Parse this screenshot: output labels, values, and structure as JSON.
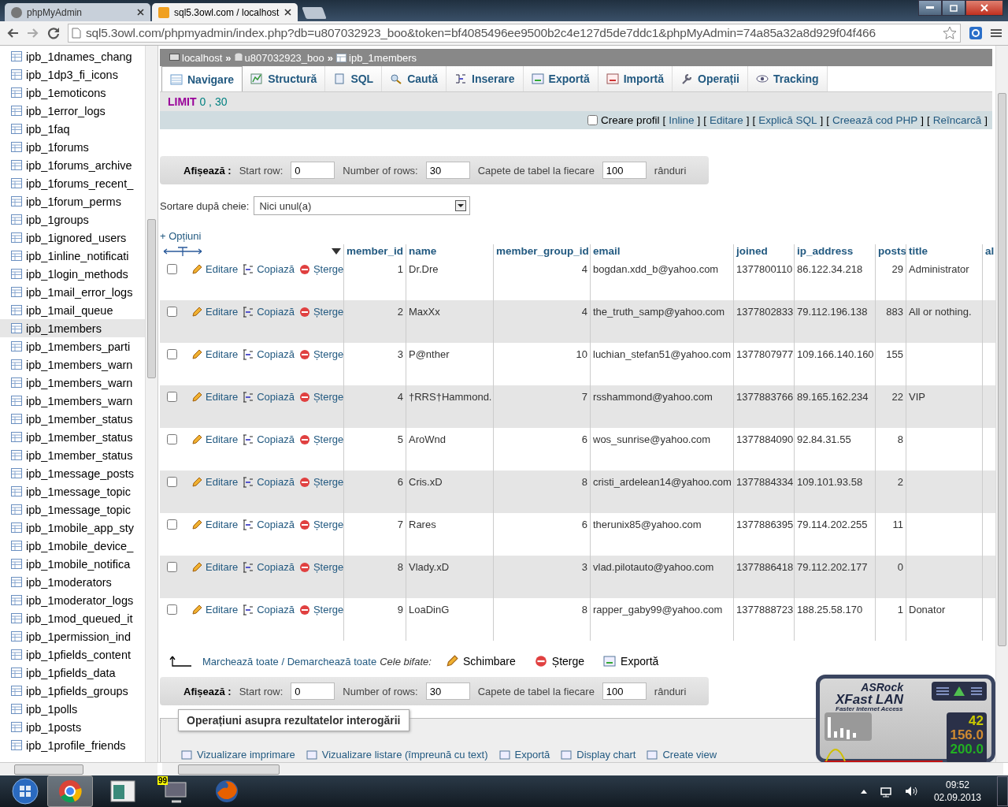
{
  "browser": {
    "tabs": [
      {
        "label": "phpMyAdmin",
        "selected": false
      },
      {
        "label": "sql5.3owl.com / localhost",
        "selected": true
      }
    ],
    "url": "sql5.3owl.com/phpmyadmin/index.php?db=u807032923_boo&token=bf4085496ee9500b2c4e127d5de7ddc1&phpMyAdmin=74a85a32a8d929f04f466"
  },
  "sidebar": {
    "items": [
      {
        "label": "ipb_1dnames_chang",
        "selected": false
      },
      {
        "label": "ipb_1dp3_fi_icons",
        "selected": false
      },
      {
        "label": "ipb_1emoticons",
        "selected": false
      },
      {
        "label": "ipb_1error_logs",
        "selected": false
      },
      {
        "label": "ipb_1faq",
        "selected": false
      },
      {
        "label": "ipb_1forums",
        "selected": false
      },
      {
        "label": "ipb_1forums_archive",
        "selected": false
      },
      {
        "label": "ipb_1forums_recent_",
        "selected": false
      },
      {
        "label": "ipb_1forum_perms",
        "selected": false
      },
      {
        "label": "ipb_1groups",
        "selected": false
      },
      {
        "label": "ipb_1ignored_users",
        "selected": false
      },
      {
        "label": "ipb_1inline_notificati",
        "selected": false
      },
      {
        "label": "ipb_1login_methods",
        "selected": false
      },
      {
        "label": "ipb_1mail_error_logs",
        "selected": false
      },
      {
        "label": "ipb_1mail_queue",
        "selected": false
      },
      {
        "label": "ipb_1members",
        "selected": true
      },
      {
        "label": "ipb_1members_parti",
        "selected": false
      },
      {
        "label": "ipb_1members_warn",
        "selected": false
      },
      {
        "label": "ipb_1members_warn",
        "selected": false
      },
      {
        "label": "ipb_1members_warn",
        "selected": false
      },
      {
        "label": "ipb_1member_status",
        "selected": false
      },
      {
        "label": "ipb_1member_status",
        "selected": false
      },
      {
        "label": "ipb_1member_status",
        "selected": false
      },
      {
        "label": "ipb_1message_posts",
        "selected": false
      },
      {
        "label": "ipb_1message_topic",
        "selected": false
      },
      {
        "label": "ipb_1message_topic",
        "selected": false
      },
      {
        "label": "ipb_1mobile_app_sty",
        "selected": false
      },
      {
        "label": "ipb_1mobile_device_",
        "selected": false
      },
      {
        "label": "ipb_1mobile_notifica",
        "selected": false
      },
      {
        "label": "ipb_1moderators",
        "selected": false
      },
      {
        "label": "ipb_1moderator_logs",
        "selected": false
      },
      {
        "label": "ipb_1mod_queued_it",
        "selected": false
      },
      {
        "label": "ipb_1permission_ind",
        "selected": false
      },
      {
        "label": "ipb_1pfields_content",
        "selected": false
      },
      {
        "label": "ipb_1pfields_data",
        "selected": false
      },
      {
        "label": "ipb_1pfields_groups",
        "selected": false
      },
      {
        "label": "ipb_1polls",
        "selected": false
      },
      {
        "label": "ipb_1posts",
        "selected": false
      },
      {
        "label": "ipb_1profile_friends",
        "selected": false
      }
    ]
  },
  "breadcrumb": [
    {
      "kind": "server",
      "label": "localhost",
      "separator": "»"
    },
    {
      "kind": "database",
      "label": "u807032923_boo",
      "separator": "»"
    },
    {
      "kind": "table",
      "label": "ipb_1members"
    }
  ],
  "tabs": [
    {
      "kind": "browse",
      "label": "Navigare",
      "selected": true
    },
    {
      "kind": "structure",
      "label": "Structură",
      "selected": false
    },
    {
      "kind": "sql",
      "label": "SQL",
      "selected": false
    },
    {
      "kind": "search",
      "label": "Caută",
      "selected": false
    },
    {
      "kind": "insert",
      "label": "Inserare",
      "selected": false
    },
    {
      "kind": "export",
      "label": "Exportă",
      "selected": false
    },
    {
      "kind": "import",
      "label": "Importă",
      "selected": false
    },
    {
      "kind": "operations",
      "label": "Operații",
      "selected": false
    },
    {
      "kind": "tracking",
      "label": "Tracking",
      "selected": false
    }
  ],
  "sql": {
    "keyword": "LIMIT",
    "value": "0 , 30"
  },
  "query_links": {
    "checkbox_label": "Creare profil",
    "checked": false,
    "links": [
      {
        "open": "[",
        "label": "Inline",
        "close": "]"
      },
      {
        "open": "[",
        "label": "Editare",
        "close": "]"
      },
      {
        "open": "[",
        "label": "Explică SQL",
        "close": "]"
      },
      {
        "open": "[",
        "label": "Creează cod PHP",
        "close": "]"
      },
      {
        "open": "[",
        "label": "Reîncarcă",
        "close": "]"
      }
    ]
  },
  "navigation_top": {
    "title": "Afișează :",
    "start_label": "Start row:",
    "start": "0",
    "rows_label": "Number of rows:",
    "rows": "30",
    "headers_label": "Capete de tabel la fiecare",
    "headers": "100",
    "suffix": "rânduri"
  },
  "sort": {
    "label": "Sortare după cheie:",
    "value": "Nici unul(a)"
  },
  "options_link": "+ Opțiuni",
  "table": {
    "columns": [
      "member_id",
      "name",
      "member_group_id",
      "email",
      "joined",
      "ip_address",
      "posts",
      "title",
      "al"
    ],
    "rows": [
      {
        "checked": false,
        "actions": [
          "Editare",
          "Copiază",
          "Șterge"
        ],
        "cells": [
          "1",
          "Dr.Dre",
          "4",
          "bogdan.xdd_b@yahoo.com",
          "1377800110",
          "86.122.34.218",
          "29",
          "Administrator"
        ]
      },
      {
        "checked": false,
        "actions": [
          "Editare",
          "Copiază",
          "Șterge"
        ],
        "cells": [
          "2",
          "MaxXx",
          "4",
          "the_truth_samp@yahoo.com",
          "1377802833",
          "79.112.196.138",
          "883",
          "All or nothing."
        ]
      },
      {
        "checked": false,
        "actions": [
          "Editare",
          "Copiază",
          "Șterge"
        ],
        "cells": [
          "3",
          "P@nther",
          "10",
          "luchian_stefan51@yahoo.com",
          "1377807977",
          "109.166.140.160",
          "155",
          ""
        ]
      },
      {
        "checked": false,
        "actions": [
          "Editare",
          "Copiază",
          "Șterge"
        ],
        "cells": [
          "4",
          "†RRS†Hammond.",
          "7",
          "rsshammond@yahoo.com",
          "1377883766",
          "89.165.162.234",
          "22",
          "VIP"
        ]
      },
      {
        "checked": false,
        "actions": [
          "Editare",
          "Copiază",
          "Șterge"
        ],
        "cells": [
          "5",
          "AroWnd",
          "6",
          "wos_sunrise@yahoo.com",
          "1377884090",
          "92.84.31.55",
          "8",
          ""
        ]
      },
      {
        "checked": false,
        "actions": [
          "Editare",
          "Copiază",
          "Șterge"
        ],
        "cells": [
          "6",
          "Cris.xD",
          "8",
          "cristi_ardelean14@yahoo.com",
          "1377884334",
          "109.101.93.58",
          "2",
          ""
        ]
      },
      {
        "checked": false,
        "actions": [
          "Editare",
          "Copiază",
          "Șterge"
        ],
        "cells": [
          "7",
          "Rares",
          "6",
          "therunix85@yahoo.com",
          "1377886395",
          "79.114.202.255",
          "11",
          ""
        ]
      },
      {
        "checked": false,
        "actions": [
          "Editare",
          "Copiază",
          "Șterge"
        ],
        "cells": [
          "8",
          "Vlady.xD",
          "3",
          "vlad.pilotauto@yahoo.com",
          "1377886418",
          "79.112.202.177",
          "0",
          ""
        ]
      },
      {
        "checked": false,
        "actions": [
          "Editare",
          "Copiază",
          "Șterge"
        ],
        "cells": [
          "9",
          "LoaDinG",
          "8",
          "rapper_gaby99@yahoo.com",
          "1377888723",
          "188.25.58.170",
          "1",
          "Donator"
        ]
      }
    ]
  },
  "bulk": {
    "mark_all": "Marchează toate / Demarchează toate",
    "with_selected": "Cele bifate:",
    "actions": [
      {
        "kind": "edit",
        "label": "Schimbare"
      },
      {
        "kind": "delete",
        "label": "Șterge"
      },
      {
        "kind": "export",
        "label": "Exportă"
      }
    ]
  },
  "navigation_bottom": {
    "title": "Afișează :",
    "start_label": "Start row:",
    "start": "0",
    "rows_label": "Number of rows:",
    "rows": "30",
    "headers_label": "Capete de tabel la fiecare",
    "headers": "100",
    "suffix": "rânduri"
  },
  "operations": {
    "legend": "Operațiuni asupra rezultatelor interogării",
    "items": [
      "Vizualizare imprimare",
      "Vizualizare listare (împreună cu text)",
      "Exportă",
      "Display chart",
      "Create view"
    ]
  },
  "widget": {
    "brand": "ASRock",
    "product": "XFast LAN",
    "tagline": "Faster Internet Access",
    "readings": [
      {
        "value": "42",
        "color": "#c8c800"
      },
      {
        "value": "156.0",
        "color": "#d08a30"
      },
      {
        "value": "200.0",
        "color": "#22b022"
      }
    ]
  },
  "taskbar": {
    "apps": [
      {
        "kind": "chrome",
        "selected": true
      },
      {
        "kind": "window",
        "selected": false
      },
      {
        "kind": "monitor",
        "selected": false,
        "badge": "99"
      },
      {
        "kind": "firefox",
        "selected": false
      }
    ],
    "time": "09:52",
    "date": "02.09.2013"
  }
}
